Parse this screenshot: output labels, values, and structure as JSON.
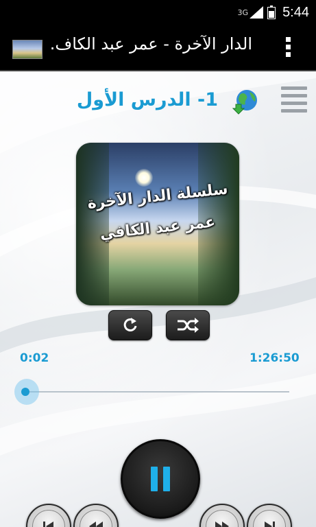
{
  "status_bar": {
    "network": "3G",
    "time": "5:44"
  },
  "action_bar": {
    "title": "الدار الآخرة - عمر عبد الكاف."
  },
  "lesson": {
    "title": "1- الدرس الأول"
  },
  "album_art": {
    "line1": "سلسلة الدار الآخرة",
    "line2": "عمر عبد الكافي"
  },
  "player": {
    "elapsed": "0:02",
    "total": "1:26:50",
    "progress_fraction": 0.0004,
    "state": "playing"
  },
  "colors": {
    "accent": "#1a9bd2",
    "action_bar": "#000000",
    "pause_icon": "#1fb0ea"
  },
  "icons": {
    "overflow": "overflow-menu-icon",
    "globe": "globe-download-icon",
    "menu": "list-menu-icon",
    "repeat": "repeat-icon",
    "shuffle": "shuffle-icon",
    "prev": "skip-previous-icon",
    "rewind": "rewind-icon",
    "pause": "pause-icon",
    "ff": "fast-forward-icon",
    "next": "skip-next-icon"
  }
}
